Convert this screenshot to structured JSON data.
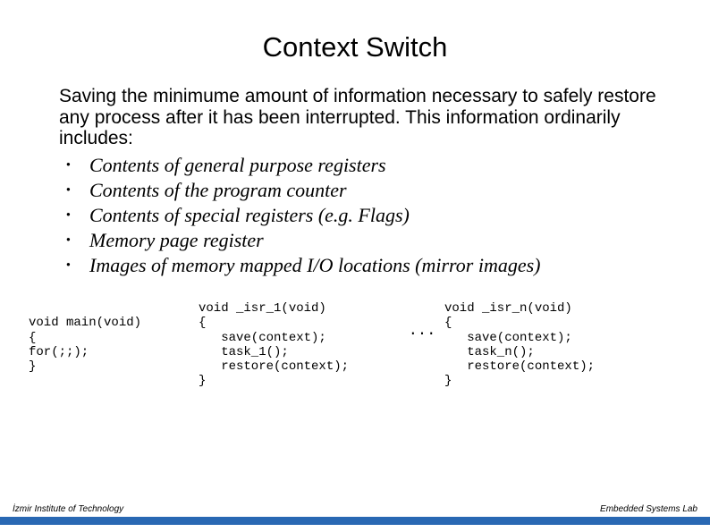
{
  "title": "Context Switch",
  "intro": "Saving the minimume amount of information necessary to safely restore any process after it has been interrupted. This information ordinarily includes:",
  "bullets": [
    "Contents of general purpose registers",
    "Contents of the program counter",
    "Contents of special registers (e.g. Flags)",
    "Memory page register",
    "Images of memory mapped I/O locations (mirror images)"
  ],
  "code": {
    "main": "void main(void)\n{\nfor(;;);\n}",
    "isr1": "void _isr_1(void)\n{\n   save(context);\n   task_1();\n   restore(context);\n}",
    "ellipsis": "...",
    "isrn": "void _isr_n(void)\n{\n   save(context);\n   task_n();\n   restore(context);\n}"
  },
  "footer": {
    "left": "İzmir Institute of Technology",
    "right": "Embedded Systems Lab"
  }
}
